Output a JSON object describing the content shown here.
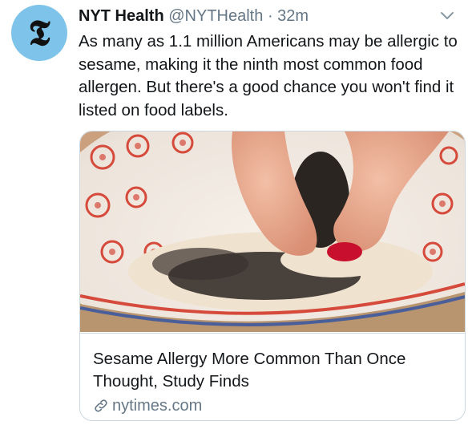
{
  "tweet": {
    "display_name": "NYT Health",
    "handle": "@NYTHealth",
    "separator": "·",
    "time": "32m",
    "avatar_glyph": "𝕿",
    "text": "As many as 1.1 million Americans may be allergic to sesame, making it the ninth most common food allergen. But there's a good chance you won't find it listed on food labels."
  },
  "card": {
    "image_icon": "photo-sesame-bowl",
    "title": "Sesame Allergy More Common Than Once Thought, Study Finds",
    "domain": "nytimes.com"
  },
  "colors": {
    "avatar_bg": "#7ec3ea",
    "muted": "#657786",
    "text": "#14171a",
    "border": "#ccd6dd"
  },
  "icons": {
    "caret": "chevron-down-icon",
    "link": "link-icon"
  }
}
